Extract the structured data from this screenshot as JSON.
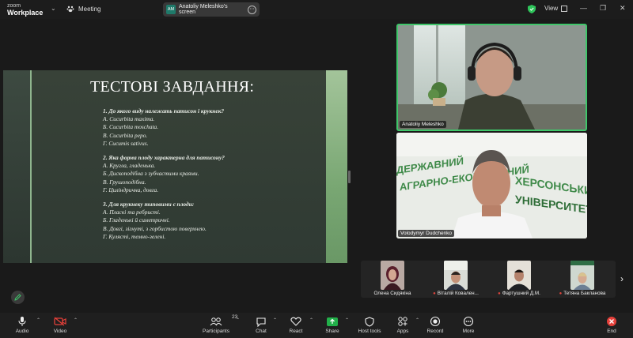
{
  "app": {
    "logo_line1": "zoom",
    "logo_line2": "Workplace"
  },
  "titlebar": {
    "meeting_label": "Meeting",
    "share_initials": "AM",
    "share_label": "Anatoliy Meleshko's screen",
    "view_label": "View"
  },
  "slide": {
    "title": "ТЕСТОВІ ЗАВДАННЯ:",
    "questions": [
      {
        "q": "1. До якого виду належать патисон і крукнек?",
        "answers": [
          "А. Cucurbita maxima.",
          "Б. Cucurbita moschata.",
          "В. Cucurbita pepo.",
          "Г. Cucumis sativus."
        ]
      },
      {
        "q": "2. Яка форма плоду характерна для патисону?",
        "answers": [
          "А. Кругла, гладенька.",
          "Б. Дископодібна з зубчастими краями.",
          "В. Грушоподібна.",
          "Г. Циліндрична, довга."
        ]
      },
      {
        "q": "3. Для крукнеку типовими є плоди:",
        "answers": [
          "А. Пласкі та ребристі.",
          "Б. Гладенькі й симетричні.",
          "В. Довгі, зігнуті, з горбистою поверхнею.",
          "Г. Кулясті, темно-зелені."
        ]
      }
    ]
  },
  "videos": [
    {
      "name": "Anatoliy Meleshko",
      "active_speaker": true
    },
    {
      "name": "Volodymyr Dudchenko",
      "active_speaker": false
    }
  ],
  "gallery": [
    {
      "name": "Олена Сидякіна",
      "muted": false
    },
    {
      "name": "Віталій Ковален...",
      "muted": true
    },
    {
      "name": "Фартушний Д.М.",
      "muted": true
    },
    {
      "name": "Тетяна Бакланова",
      "muted": true
    }
  ],
  "toolbar": {
    "audio": "Audio",
    "video": "Video",
    "participants": "Participants",
    "participants_count": "23",
    "chat": "Chat",
    "react": "React",
    "share": "Share",
    "host_tools": "Host tools",
    "apps": "Apps",
    "record": "Record",
    "more": "More",
    "end": "End"
  },
  "colors": {
    "accent_green": "#3fc66a",
    "share_green": "#22b04a",
    "end_red": "#e5403a"
  }
}
